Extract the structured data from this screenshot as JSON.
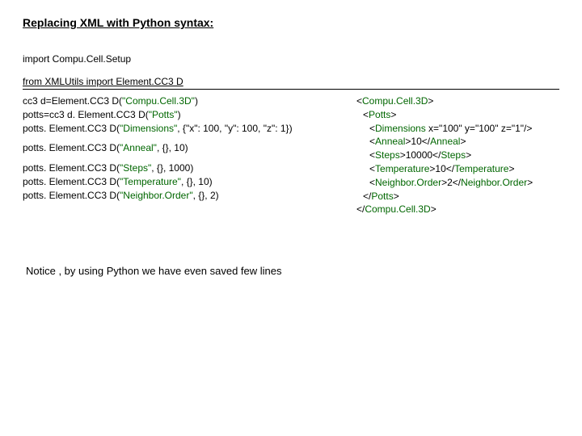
{
  "title": "Replacing XML with Python syntax:",
  "importLine": "import Compu.Cell.Setup",
  "fromLine": "from XMLUtils import Element.CC3 D",
  "python": {
    "l1a": "cc3 d=Element.CC3 D(",
    "l1b": "\"Compu.Cell.3D\"",
    "l1c": ")",
    "l2a": "potts=cc3 d. Element.CC3 D(",
    "l2b": "\"Potts\"",
    "l2c": ")",
    "l3a": "potts. Element.CC3 D(",
    "l3b": "\"Dimensions\"",
    "l3c": ", {\"x\": 100, \"y\": 100, \"z\": 1})",
    "l4a": "potts. Element.CC3 D(",
    "l4b": "\"Anneal\"",
    "l4c": ", {}, 10)",
    "l5a": "potts. Element.CC3 D(",
    "l5b": "\"Steps\"",
    "l5c": ", {}, 1000)",
    "l6a": "potts. Element.CC3 D(",
    "l6b": "\"Temperature\"",
    "l6c": ", {}, 10)",
    "l7a": "potts. Element.CC3 D(",
    "l7b": "\"Neighbor.Order\"",
    "l7c": ", {}, 2)"
  },
  "xml": {
    "l1o": "<",
    "l1t": "Compu.Cell.3D",
    "l1c": ">",
    "l2o": "<",
    "l2t": "Potts",
    "l2c": ">",
    "l3o": "<",
    "l3t": "Dimensions",
    "l3a": " x=\"100\" y=\"100\" z=\"1\"/>",
    "l4o": "<",
    "l4t": "Anneal",
    "l4m": ">10</",
    "l4t2": "Anneal",
    "l4c": ">",
    "l5o": "<",
    "l5t": "Steps",
    "l5m": ">10000</",
    "l5t2": "Steps",
    "l5c": ">",
    "l6o": "<",
    "l6t": "Temperature",
    "l6m": ">10</",
    "l6t2": "Temperature",
    "l6c": ">",
    "l7o": "<",
    "l7t": "Neighbor.Order",
    "l7m": ">2</",
    "l7t2": "Neighbor.Order",
    "l7c": ">",
    "l8o": "</",
    "l8t": "Potts",
    "l8c": ">",
    "l9o": "</",
    "l9t": "Compu.Cell.3D",
    "l9c": ">"
  },
  "footer": "Notice , by using Python we have even saved few lines"
}
